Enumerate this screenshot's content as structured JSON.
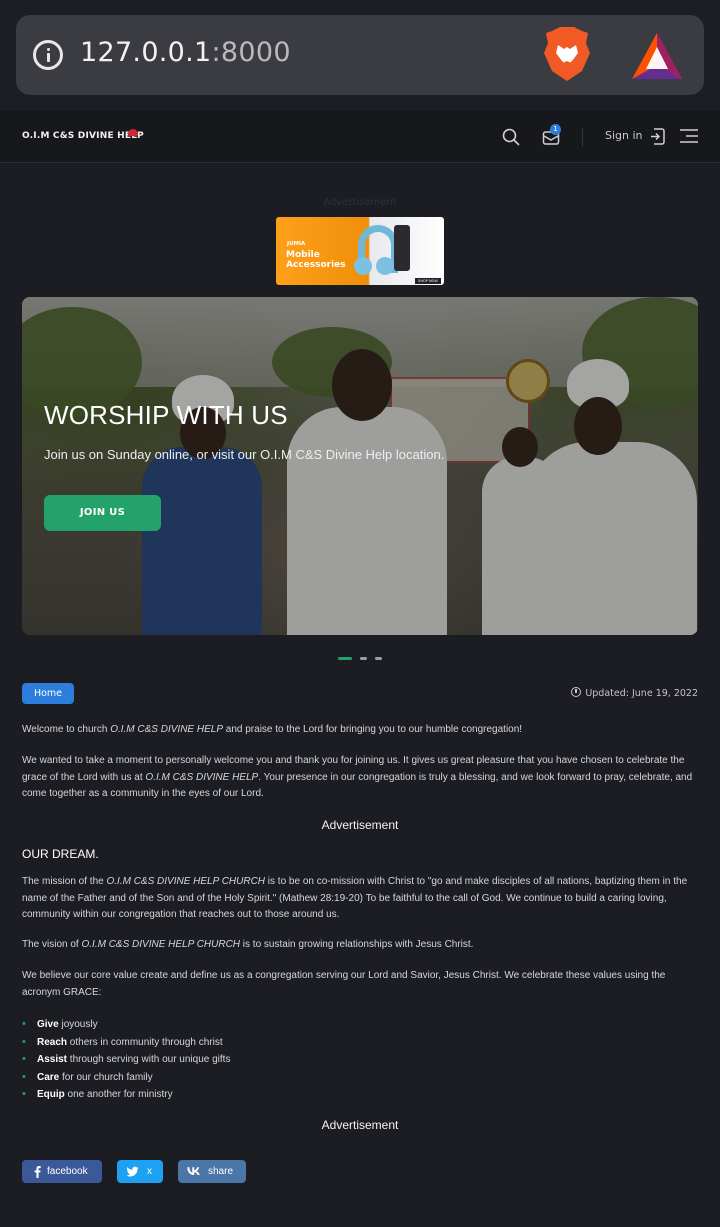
{
  "browser": {
    "url_host": "127.0.0.1",
    "url_port": ":8000"
  },
  "header": {
    "logo_text": "O.I.M C&S DIVINE HELP",
    "mail_badge": "1",
    "signin_label": "Sign in"
  },
  "ad_top": {
    "label": "Advertisement",
    "brand": "JUMIA",
    "title": "Mobile Accessories",
    "cta": "SHOP NOW"
  },
  "hero": {
    "title": "WORSHIP WITH US",
    "subtitle": "Join us on Sunday online, or visit our O.I.M C&S Divine Help location.",
    "button_label": "JOIN US"
  },
  "meta": {
    "breadcrumb": "Home",
    "updated": "Updated: June 19, 2022"
  },
  "content": {
    "p1_a": "Welcome to church ",
    "p1_em": "O.I.M C&S DIVINE HELP",
    "p1_b": " and praise to the Lord for bringing you to our humble congregation!",
    "p2_a": "We wanted to take a moment to personally welcome you and thank you for joining us. It gives us great pleasure that you have chosen to celebrate the grace of the Lord with us at ",
    "p2_em": "O.I.M C&S DIVINE HELP",
    "p2_b": ". Your presence in our congregation is truly a blessing, and we look forward to pray, celebrate, and come together as a community in the eyes of our Lord.",
    "ad_label_1": "Advertisement",
    "heading": "OUR DREAM.",
    "p3_a": "The mission of the ",
    "p3_em": "O.I.M C&S DIVINE HELP CHURCH",
    "p3_b": " is to be on co-mission with Christ to \"go and make disciples of all nations, baptizing them in the name of the Father and of the Son and of the Holy Spirit.\" (Mathew 28:19-20) To be faithful to the call of God. We continue to build a caring loving, community within our congregation that reaches out to those around us.",
    "p4_a": "The vision of ",
    "p4_em": "O.I.M C&S DIVINE HELP CHURCH",
    "p4_b": " is to sustain growing relationships with Jesus Christ.",
    "p5": "We believe our core value create and define us as a congregation serving our Lord and Savior, Jesus Christ. We celebrate these values using the acronym GRACE:",
    "grace": [
      {
        "word": "Give",
        "rest": " joyously"
      },
      {
        "word": "Reach",
        "rest": " others in community through christ"
      },
      {
        "word": "Assist",
        "rest": " through serving with our unique gifts"
      },
      {
        "word": "Care",
        "rest": " for our church family"
      },
      {
        "word": "Equip",
        "rest": " one another for ministry"
      }
    ],
    "ad_label_2": "Advertisement"
  },
  "share": {
    "facebook": "facebook",
    "twitter": "x",
    "vk": "share"
  },
  "colors": {
    "accent_green": "#23a36b",
    "accent_blue": "#2d7ddc",
    "facebook": "#3b5998",
    "twitter": "#1da1f2",
    "vk": "#4a76a8"
  },
  "icons": [
    "info-icon",
    "brave-lion-icon",
    "bat-triangle-icon",
    "search-icon",
    "mail-icon",
    "signin-icon",
    "menu-icon",
    "clock-icon",
    "facebook-icon",
    "twitter-icon",
    "vk-icon"
  ]
}
